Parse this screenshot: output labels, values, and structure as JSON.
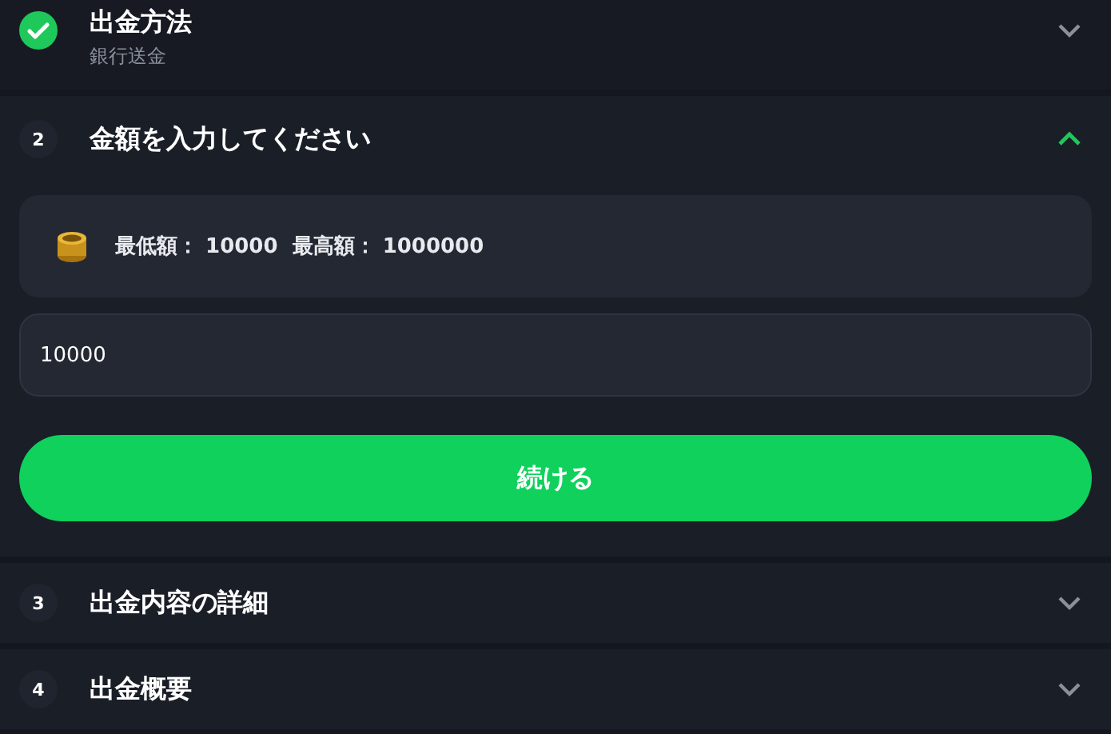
{
  "steps": [
    {
      "kind": "done",
      "title": "出金方法",
      "subtitle": "銀行送金",
      "expanded": false
    },
    {
      "kind": "number",
      "number": "2",
      "title": "金額を入力してください",
      "expanded": true
    },
    {
      "kind": "number",
      "number": "3",
      "title": "出金内容の詳細",
      "expanded": false
    },
    {
      "kind": "number",
      "number": "4",
      "title": "出金概要",
      "expanded": false
    }
  ],
  "limits": "最低額： 10000  最高額： 1000000",
  "amount_field": {
    "value": "10000"
  },
  "continue_button": "続ける"
}
